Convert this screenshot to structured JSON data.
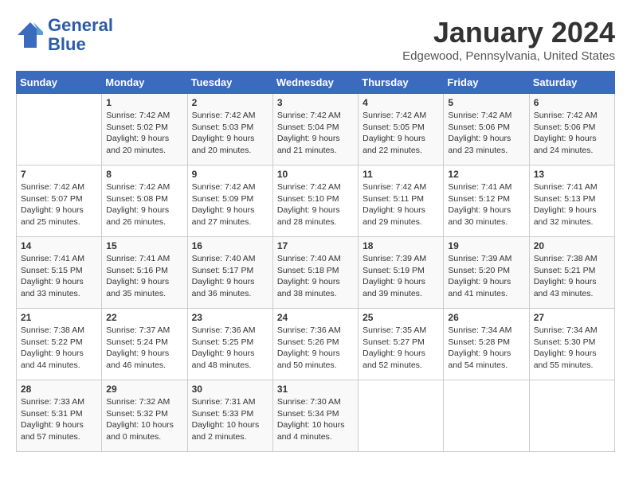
{
  "header": {
    "logo_line1": "General",
    "logo_line2": "Blue",
    "month": "January 2024",
    "location": "Edgewood, Pennsylvania, United States"
  },
  "days_of_week": [
    "Sunday",
    "Monday",
    "Tuesday",
    "Wednesday",
    "Thursday",
    "Friday",
    "Saturday"
  ],
  "weeks": [
    [
      {
        "day": "",
        "content": ""
      },
      {
        "day": "1",
        "content": "Sunrise: 7:42 AM\nSunset: 5:02 PM\nDaylight: 9 hours and 20 minutes."
      },
      {
        "day": "2",
        "content": "Sunrise: 7:42 AM\nSunset: 5:03 PM\nDaylight: 9 hours and 20 minutes."
      },
      {
        "day": "3",
        "content": "Sunrise: 7:42 AM\nSunset: 5:04 PM\nDaylight: 9 hours and 21 minutes."
      },
      {
        "day": "4",
        "content": "Sunrise: 7:42 AM\nSunset: 5:05 PM\nDaylight: 9 hours and 22 minutes."
      },
      {
        "day": "5",
        "content": "Sunrise: 7:42 AM\nSunset: 5:06 PM\nDaylight: 9 hours and 23 minutes."
      },
      {
        "day": "6",
        "content": "Sunrise: 7:42 AM\nSunset: 5:06 PM\nDaylight: 9 hours and 24 minutes."
      }
    ],
    [
      {
        "day": "7",
        "content": "Sunrise: 7:42 AM\nSunset: 5:07 PM\nDaylight: 9 hours and 25 minutes."
      },
      {
        "day": "8",
        "content": "Sunrise: 7:42 AM\nSunset: 5:08 PM\nDaylight: 9 hours and 26 minutes."
      },
      {
        "day": "9",
        "content": "Sunrise: 7:42 AM\nSunset: 5:09 PM\nDaylight: 9 hours and 27 minutes."
      },
      {
        "day": "10",
        "content": "Sunrise: 7:42 AM\nSunset: 5:10 PM\nDaylight: 9 hours and 28 minutes."
      },
      {
        "day": "11",
        "content": "Sunrise: 7:42 AM\nSunset: 5:11 PM\nDaylight: 9 hours and 29 minutes."
      },
      {
        "day": "12",
        "content": "Sunrise: 7:41 AM\nSunset: 5:12 PM\nDaylight: 9 hours and 30 minutes."
      },
      {
        "day": "13",
        "content": "Sunrise: 7:41 AM\nSunset: 5:13 PM\nDaylight: 9 hours and 32 minutes."
      }
    ],
    [
      {
        "day": "14",
        "content": "Sunrise: 7:41 AM\nSunset: 5:15 PM\nDaylight: 9 hours and 33 minutes."
      },
      {
        "day": "15",
        "content": "Sunrise: 7:41 AM\nSunset: 5:16 PM\nDaylight: 9 hours and 35 minutes."
      },
      {
        "day": "16",
        "content": "Sunrise: 7:40 AM\nSunset: 5:17 PM\nDaylight: 9 hours and 36 minutes."
      },
      {
        "day": "17",
        "content": "Sunrise: 7:40 AM\nSunset: 5:18 PM\nDaylight: 9 hours and 38 minutes."
      },
      {
        "day": "18",
        "content": "Sunrise: 7:39 AM\nSunset: 5:19 PM\nDaylight: 9 hours and 39 minutes."
      },
      {
        "day": "19",
        "content": "Sunrise: 7:39 AM\nSunset: 5:20 PM\nDaylight: 9 hours and 41 minutes."
      },
      {
        "day": "20",
        "content": "Sunrise: 7:38 AM\nSunset: 5:21 PM\nDaylight: 9 hours and 43 minutes."
      }
    ],
    [
      {
        "day": "21",
        "content": "Sunrise: 7:38 AM\nSunset: 5:22 PM\nDaylight: 9 hours and 44 minutes."
      },
      {
        "day": "22",
        "content": "Sunrise: 7:37 AM\nSunset: 5:24 PM\nDaylight: 9 hours and 46 minutes."
      },
      {
        "day": "23",
        "content": "Sunrise: 7:36 AM\nSunset: 5:25 PM\nDaylight: 9 hours and 48 minutes."
      },
      {
        "day": "24",
        "content": "Sunrise: 7:36 AM\nSunset: 5:26 PM\nDaylight: 9 hours and 50 minutes."
      },
      {
        "day": "25",
        "content": "Sunrise: 7:35 AM\nSunset: 5:27 PM\nDaylight: 9 hours and 52 minutes."
      },
      {
        "day": "26",
        "content": "Sunrise: 7:34 AM\nSunset: 5:28 PM\nDaylight: 9 hours and 54 minutes."
      },
      {
        "day": "27",
        "content": "Sunrise: 7:34 AM\nSunset: 5:30 PM\nDaylight: 9 hours and 55 minutes."
      }
    ],
    [
      {
        "day": "28",
        "content": "Sunrise: 7:33 AM\nSunset: 5:31 PM\nDaylight: 9 hours and 57 minutes."
      },
      {
        "day": "29",
        "content": "Sunrise: 7:32 AM\nSunset: 5:32 PM\nDaylight: 10 hours and 0 minutes."
      },
      {
        "day": "30",
        "content": "Sunrise: 7:31 AM\nSunset: 5:33 PM\nDaylight: 10 hours and 2 minutes."
      },
      {
        "day": "31",
        "content": "Sunrise: 7:30 AM\nSunset: 5:34 PM\nDaylight: 10 hours and 4 minutes."
      },
      {
        "day": "",
        "content": ""
      },
      {
        "day": "",
        "content": ""
      },
      {
        "day": "",
        "content": ""
      }
    ]
  ]
}
